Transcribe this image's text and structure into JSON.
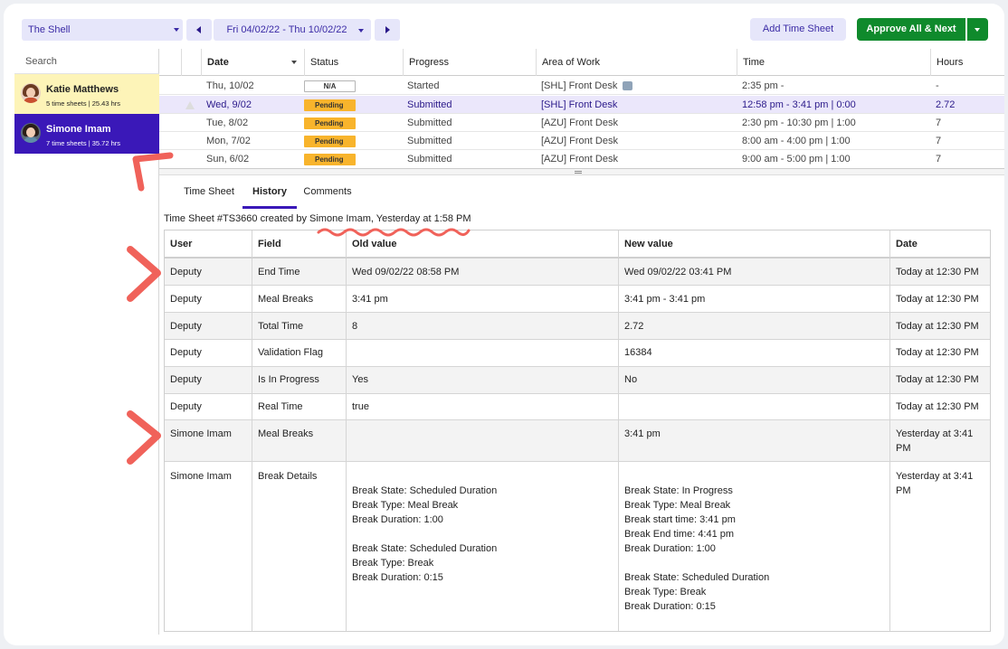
{
  "toolbar": {
    "location": "The Shell",
    "date_range": "Fri 04/02/22 - Thu 10/02/22",
    "add_time_sheet": "Add Time Sheet",
    "approve_all_next": "Approve All & Next"
  },
  "sidebar": {
    "search_placeholder": "Search",
    "employees": [
      {
        "name": "Katie Matthews",
        "summary": "5 time sheets | 25.43 hrs"
      },
      {
        "name": "Simone Imam",
        "summary": "7 time sheets | 35.72 hrs"
      }
    ]
  },
  "grid": {
    "headers": {
      "date": "Date",
      "status": "Status",
      "progress": "Progress",
      "area": "Area of Work",
      "time": "Time",
      "hours": "Hours"
    },
    "rows": [
      {
        "date": "Thu, 10/02",
        "status": "N/A",
        "progress": "Started",
        "area": "[SHL] Front Desk",
        "time": "2:35 pm -",
        "hours": "-"
      },
      {
        "date": "Wed, 9/02",
        "status": "Pending",
        "progress": "Submitted",
        "area": "[SHL] Front Desk",
        "time": "12:58 pm - 3:41 pm | 0:00",
        "hours": "2.72"
      },
      {
        "date": "Tue, 8/02",
        "status": "Pending",
        "progress": "Submitted",
        "area": "[AZU] Front Desk",
        "time": "2:30 pm - 10:30 pm | 1:00",
        "hours": "7"
      },
      {
        "date": "Mon, 7/02",
        "status": "Pending",
        "progress": "Submitted",
        "area": "[AZU] Front Desk",
        "time": "8:00 am - 4:00 pm | 1:00",
        "hours": "7"
      },
      {
        "date": "Sun, 6/02",
        "status": "Pending",
        "progress": "Submitted",
        "area": "[AZU] Front Desk",
        "time": "9:00 am - 5:00 pm | 1:00",
        "hours": "7"
      }
    ]
  },
  "tabs": [
    "Time Sheet",
    "History",
    "Comments"
  ],
  "history": {
    "caption": "Time Sheet #TS3660  created by Simone Imam, Yesterday at 1:58 PM",
    "headers": {
      "user": "User",
      "field": "Field",
      "old": "Old value",
      "new": "New value",
      "date": "Date"
    },
    "rows": [
      {
        "user": "Deputy",
        "field": "End Time",
        "old": "Wed 09/02/22 08:58 PM",
        "new": "Wed 09/02/22 03:41 PM",
        "date": "Today at 12:30 PM"
      },
      {
        "user": "Deputy",
        "field": "Meal Breaks",
        "old": "3:41 pm",
        "new": "3:41 pm - 3:41 pm",
        "date": "Today at 12:30 PM"
      },
      {
        "user": "Deputy",
        "field": "Total Time",
        "old": "8",
        "new": "2.72",
        "date": "Today at 12:30 PM"
      },
      {
        "user": "Deputy",
        "field": "Validation Flag",
        "old": "",
        "new": "16384",
        "date": "Today at 12:30 PM"
      },
      {
        "user": "Deputy",
        "field": "Is In Progress",
        "old": "Yes",
        "new": "No",
        "date": "Today at 12:30 PM"
      },
      {
        "user": "Deputy",
        "field": "Real Time",
        "old": "true",
        "new": "",
        "date": "Today at 12:30 PM"
      },
      {
        "user": "Simone Imam",
        "field": "Meal Breaks",
        "old": "",
        "new": "3:41 pm",
        "date": "Yesterday at 3:41\nPM"
      },
      {
        "user": "Simone Imam",
        "field": "Break Details",
        "old": "\nBreak State: Scheduled Duration\nBreak Type: Meal Break\nBreak Duration: 1:00\n\nBreak State: Scheduled Duration\nBreak Type: Break\nBreak Duration: 0:15",
        "new": "\nBreak State: In Progress\nBreak Type: Meal Break\nBreak start time: 3:41 pm\nBreak End time: 4:41 pm\nBreak Duration: 1:00\n\nBreak State: Scheduled Duration\nBreak Type: Break\nBreak Duration: 0:15",
        "date": "Yesterday at 3:41\nPM"
      }
    ]
  },
  "colors": {
    "accent": "#3a18b8",
    "approve": "#0f8a2c",
    "pending": "#f8b42c",
    "annotation": "#f0625a"
  }
}
